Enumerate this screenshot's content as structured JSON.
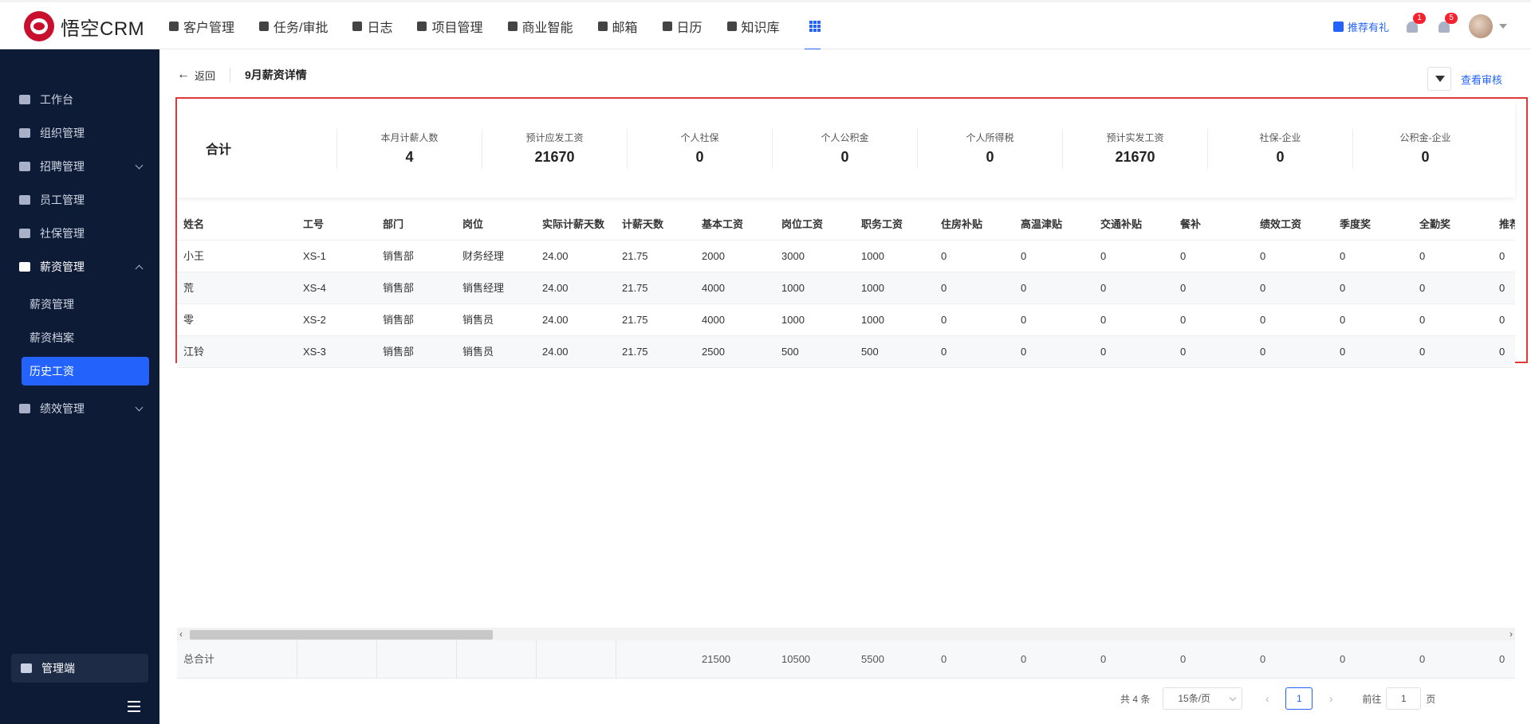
{
  "app": {
    "logo_text": "悟空CRM"
  },
  "nav": {
    "items": [
      "客户管理",
      "任务/审批",
      "日志",
      "项目管理",
      "商业智能",
      "邮箱",
      "日历",
      "知识库"
    ],
    "gift_label": "推荐有礼",
    "notice_badge": "1",
    "bell_badge": "5"
  },
  "sidebar": {
    "items": [
      "工作台",
      "组织管理",
      "招聘管理",
      "员工管理",
      "社保管理",
      "薪资管理",
      "绩效管理"
    ],
    "subitems": [
      "薪资管理",
      "薪资档案",
      "历史工资"
    ],
    "admin": "管理端"
  },
  "header": {
    "back": "返回",
    "title": "9月薪资详情",
    "review_link": "查看审核"
  },
  "summary": {
    "title": "合计",
    "cells": [
      {
        "label": "本月计薪人数",
        "value": "4"
      },
      {
        "label": "预计应发工资",
        "value": "21670"
      },
      {
        "label": "个人社保",
        "value": "0"
      },
      {
        "label": "个人公积金",
        "value": "0"
      },
      {
        "label": "个人所得税",
        "value": "0"
      },
      {
        "label": "预计实发工资",
        "value": "21670"
      },
      {
        "label": "社保-企业",
        "value": "0"
      },
      {
        "label": "公积金-企业",
        "value": "0"
      }
    ]
  },
  "table": {
    "columns": [
      "姓名",
      "工号",
      "部门",
      "岗位",
      "实际计薪天数",
      "计薪天数",
      "基本工资",
      "岗位工资",
      "职务工资",
      "住房补贴",
      "高温津贴",
      "交通补贴",
      "餐补",
      "绩效工资",
      "季度奖",
      "全勤奖",
      "推荐"
    ],
    "rows": [
      [
        "小王",
        "XS-1",
        "销售部",
        "财务经理",
        "24.00",
        "21.75",
        "2000",
        "3000",
        "1000",
        "0",
        "0",
        "0",
        "0",
        "0",
        "0",
        "0",
        "0"
      ],
      [
        "荒",
        "XS-4",
        "销售部",
        "销售经理",
        "24.00",
        "21.75",
        "4000",
        "1000",
        "1000",
        "0",
        "0",
        "0",
        "0",
        "0",
        "0",
        "0",
        "0"
      ],
      [
        "零",
        "XS-2",
        "销售部",
        "销售员",
        "24.00",
        "21.75",
        "4000",
        "1000",
        "1000",
        "0",
        "0",
        "0",
        "0",
        "0",
        "0",
        "0",
        "0"
      ],
      [
        "江铃",
        "XS-3",
        "销售部",
        "销售员",
        "24.00",
        "21.75",
        "2500",
        "500",
        "500",
        "0",
        "0",
        "0",
        "0",
        "0",
        "0",
        "0",
        "0"
      ]
    ],
    "totals": [
      "总合计",
      "",
      "",
      "",
      "",
      "",
      "21500",
      "10500",
      "5500",
      "0",
      "0",
      "0",
      "0",
      "0",
      "0",
      "0",
      "0"
    ]
  },
  "pager": {
    "total": "共 4 条",
    "size": "15条/页",
    "page": "1",
    "goto_prefix": "前往",
    "goto_value": "1",
    "goto_suffix": "页",
    "prev": "‹",
    "next": "›"
  },
  "scroll": {
    "left": "‹",
    "right": "›"
  }
}
